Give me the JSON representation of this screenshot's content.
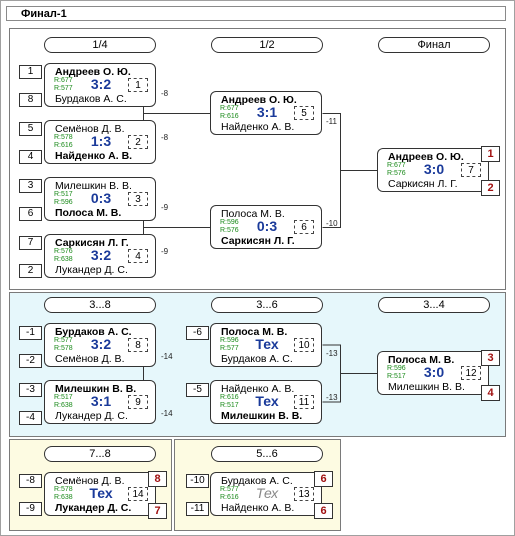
{
  "title": "Финал-1",
  "sections": {
    "main": {
      "round_labels": [
        "1/4",
        "1/2",
        "Финал"
      ]
    },
    "s38": {
      "round_labels": [
        "3...8",
        "3...6",
        "3...4"
      ]
    },
    "s78": {
      "round_label": "7...8"
    },
    "s56": {
      "round_label": "5...6"
    }
  },
  "seeds": {
    "q1_top": "1",
    "q1_bot": "8",
    "q2_top": "5",
    "q2_bot": "4",
    "q3_top": "3",
    "q3_bot": "6",
    "q4_top": "7",
    "q4_bot": "2",
    "m8_top": "-1",
    "m8_bot": "-2",
    "m9_top": "-3",
    "m9_bot": "-4",
    "m10_top": "-6",
    "m11_top": "-5",
    "m14_top": "-8",
    "m14_bot": "-9",
    "m13_top": "-10",
    "m13_bot": "-11"
  },
  "matches": {
    "m1": {
      "p1": "Андреев О. Ю.",
      "p2": "Бурдаков А. С.",
      "r1": "R:677",
      "r2": "R:577",
      "score": "3:2",
      "num": "1",
      "ref": "-8"
    },
    "m2": {
      "p1": "Семёнов Д. В.",
      "p2": "Найденко А. В.",
      "r1": "R:578",
      "r2": "R:616",
      "score": "1:3",
      "num": "2",
      "ref": "-8"
    },
    "m3": {
      "p1": "Милешкин В. В.",
      "p2": "Полоса М. В.",
      "r1": "R:517",
      "r2": "R:596",
      "score": "0:3",
      "num": "3",
      "ref": "-9"
    },
    "m4": {
      "p1": "Саркисян Л. Г.",
      "p2": "Лукандер Д. С.",
      "r1": "R:576",
      "r2": "R:638",
      "score": "3:2",
      "num": "4",
      "ref": "-9"
    },
    "m5": {
      "p1": "Андреев О. Ю.",
      "p2": "Найденко А. В.",
      "r1": "R:677",
      "r2": "R:616",
      "score": "3:1",
      "num": "5",
      "ref": "-11"
    },
    "m6": {
      "p1": "Полоса М. В.",
      "p2": "Саркисян Л. Г.",
      "r1": "R:596",
      "r2": "R:576",
      "score": "0:3",
      "num": "6",
      "ref": "-10"
    },
    "m7": {
      "p1": "Андреев О. Ю.",
      "p2": "Саркисян Л. Г.",
      "r1": "R:677",
      "r2": "R:576",
      "score": "3:0",
      "num": "7",
      "place1": "1",
      "place2": "2"
    },
    "m8": {
      "p1": "Бурдаков А. С.",
      "p2": "Семёнов Д. В.",
      "r1": "R:577",
      "r2": "R:578",
      "score": "3:2",
      "num": "8",
      "ref": "-14"
    },
    "m9": {
      "p1": "Милешкин В. В.",
      "p2": "Лукандер Д. С.",
      "r1": "R:517",
      "r2": "R:638",
      "score": "3:1",
      "num": "9",
      "ref": "-14"
    },
    "m10": {
      "p1": "Полоса М. В.",
      "p2": "Бурдаков А. С.",
      "r1": "R:596",
      "r2": "R:577",
      "score": "Тех",
      "num": "10",
      "ref": "-13"
    },
    "m11": {
      "p1": "Найденко А. В.",
      "p2": "Милешкин В. В.",
      "r1": "R:616",
      "r2": "R:517",
      "score": "Тех",
      "num": "11",
      "ref": "-13"
    },
    "m12": {
      "p1": "Полоса М. В.",
      "p2": "Милешкин В. В.",
      "r1": "R:596",
      "r2": "R:517",
      "score": "3:0",
      "num": "12",
      "place1": "3",
      "place2": "4"
    },
    "m14": {
      "p1": "Семёнов Д. В.",
      "p2": "Лукандер Д. С.",
      "r1": "R:578",
      "r2": "R:638",
      "score": "Тех",
      "num": "14",
      "place1": "8",
      "place2": "7"
    },
    "m13": {
      "p1": "Бурдаков А. С.",
      "p2": "Найденко А. В.",
      "r1": "R:577",
      "r2": "R:616",
      "score": "Тех",
      "num": "13",
      "place1": "6",
      "place2": "6"
    }
  },
  "colors": {
    "panel_main": "#ffffff",
    "panel_38": "#e6f7fb",
    "panel_low": "#fdfbe2",
    "score": "#1a3a9a",
    "rating": "#1a8a1a",
    "place": "#a01010"
  }
}
